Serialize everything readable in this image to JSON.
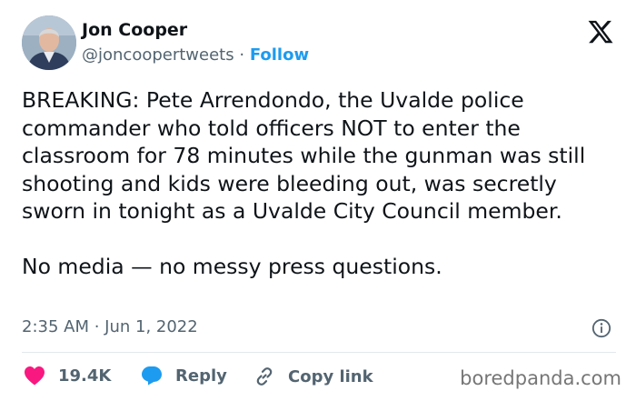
{
  "author": {
    "name": "Jon Cooper",
    "handle": "@joncoopertweets",
    "separator": "·",
    "follow_label": "Follow"
  },
  "tweet": {
    "text": "BREAKING: Pete Arrendondo, the Uvalde police commander who told officers NOT to enter the classroom for 78 minutes while the gunman was still shooting and kids were bleeding out, was secretly sworn in tonight as a Uvalde City Council member.\n\nNo media — no messy press questions.",
    "timestamp": "2:35 AM · Jun 1, 2022"
  },
  "actions": {
    "likes": "19.4K",
    "reply_label": "Reply",
    "copy_link_label": "Copy link"
  },
  "watermark": "boredpanda.com",
  "colors": {
    "like": "#f91880",
    "reply": "#1d9bf0",
    "link": "#1d9bf0",
    "secondary_text": "#536471"
  },
  "icons": [
    "avatar",
    "x-logo-icon",
    "info-icon",
    "heart-icon",
    "reply-bubble-icon",
    "link-icon"
  ]
}
